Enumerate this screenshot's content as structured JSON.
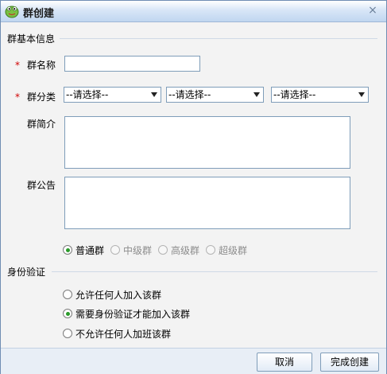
{
  "window": {
    "title": "群创建",
    "close_glyph": "×"
  },
  "group_info": {
    "section_label": "群基本信息",
    "name_label": "群名称",
    "name_value": "",
    "category_label": "群分类",
    "required_mark": "*",
    "category_selects": [
      {
        "value": "--请选择--"
      },
      {
        "value": "--请选择--"
      },
      {
        "value": "--请选择--"
      }
    ],
    "intro_label": "群简介",
    "intro_value": "",
    "notice_label": "群公告",
    "notice_value": "",
    "group_types": [
      {
        "label": "普通群",
        "checked": true,
        "disabled": false
      },
      {
        "label": "中级群",
        "checked": false,
        "disabled": true
      },
      {
        "label": "高级群",
        "checked": false,
        "disabled": true
      },
      {
        "label": "超级群",
        "checked": false,
        "disabled": true
      }
    ]
  },
  "verification": {
    "section_label": "身份验证",
    "options": [
      {
        "label": "允许任何人加入该群",
        "checked": false
      },
      {
        "label": "需要身份验证才能加入该群",
        "checked": true
      },
      {
        "label": "不允许任何人加班该群",
        "checked": false
      }
    ]
  },
  "footer": {
    "cancel_label": "取消",
    "create_label": "完成创建"
  },
  "icons": {
    "app": "frog-icon",
    "close": "close-icon",
    "dropdown": "chevron-down-icon"
  },
  "colors": {
    "required": "#d00000",
    "radio_checked": "#2a9a2a",
    "border": "#7f9db9",
    "titlebar": "#c0d6f0"
  }
}
